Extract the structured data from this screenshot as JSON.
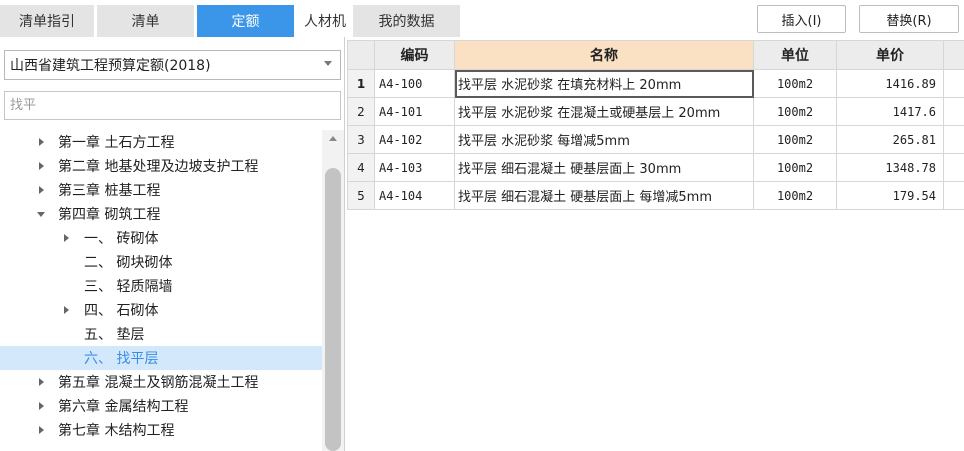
{
  "tabs": [
    "清单指引",
    "清单",
    "定额",
    "人材机",
    "我的数据"
  ],
  "toolbar": {
    "insert_label": "插入(I)",
    "replace_label": "替换(R)"
  },
  "left": {
    "standard": "山西省建筑工程预算定额(2018)",
    "search_placeholder": "找平",
    "tree": [
      {
        "label": "第一章 土石方工程"
      },
      {
        "label": "第二章 地基处理及边坡支护工程"
      },
      {
        "label": "第三章 桩基工程"
      },
      {
        "label": "第四章 砌筑工程"
      },
      {
        "label": "一、 砖砌体"
      },
      {
        "label": "二、 砌块砌体"
      },
      {
        "label": "三、 轻质隔墙"
      },
      {
        "label": "四、 石砌体"
      },
      {
        "label": "五、 垫层"
      },
      {
        "label": "六、 找平层"
      },
      {
        "label": "第五章 混凝土及钢筋混凝土工程"
      },
      {
        "label": "第六章 金属结构工程"
      },
      {
        "label": "第七章 木结构工程"
      }
    ]
  },
  "grid": {
    "columns": [
      "编码",
      "名称",
      "单位",
      "单价"
    ],
    "rows": [
      {
        "no": "1",
        "code": "A4-100",
        "name": "找平层 水泥砂浆 在填充材料上 20mm",
        "unit": "100m2",
        "price": "1416.89"
      },
      {
        "no": "2",
        "code": "A4-101",
        "name": "找平层 水泥砂浆 在混凝土或硬基层上 20mm",
        "unit": "100m2",
        "price": "1417.6"
      },
      {
        "no": "3",
        "code": "A4-102",
        "name": "找平层 水泥砂浆 每增减5mm",
        "unit": "100m2",
        "price": "265.81"
      },
      {
        "no": "4",
        "code": "A4-103",
        "name": "找平层 细石混凝土 硬基层面上 30mm",
        "unit": "100m2",
        "price": "1348.78"
      },
      {
        "no": "5",
        "code": "A4-104",
        "name": "找平层 细石混凝土 硬基层面上 每增减5mm",
        "unit": "100m2",
        "price": "179.54"
      }
    ]
  }
}
